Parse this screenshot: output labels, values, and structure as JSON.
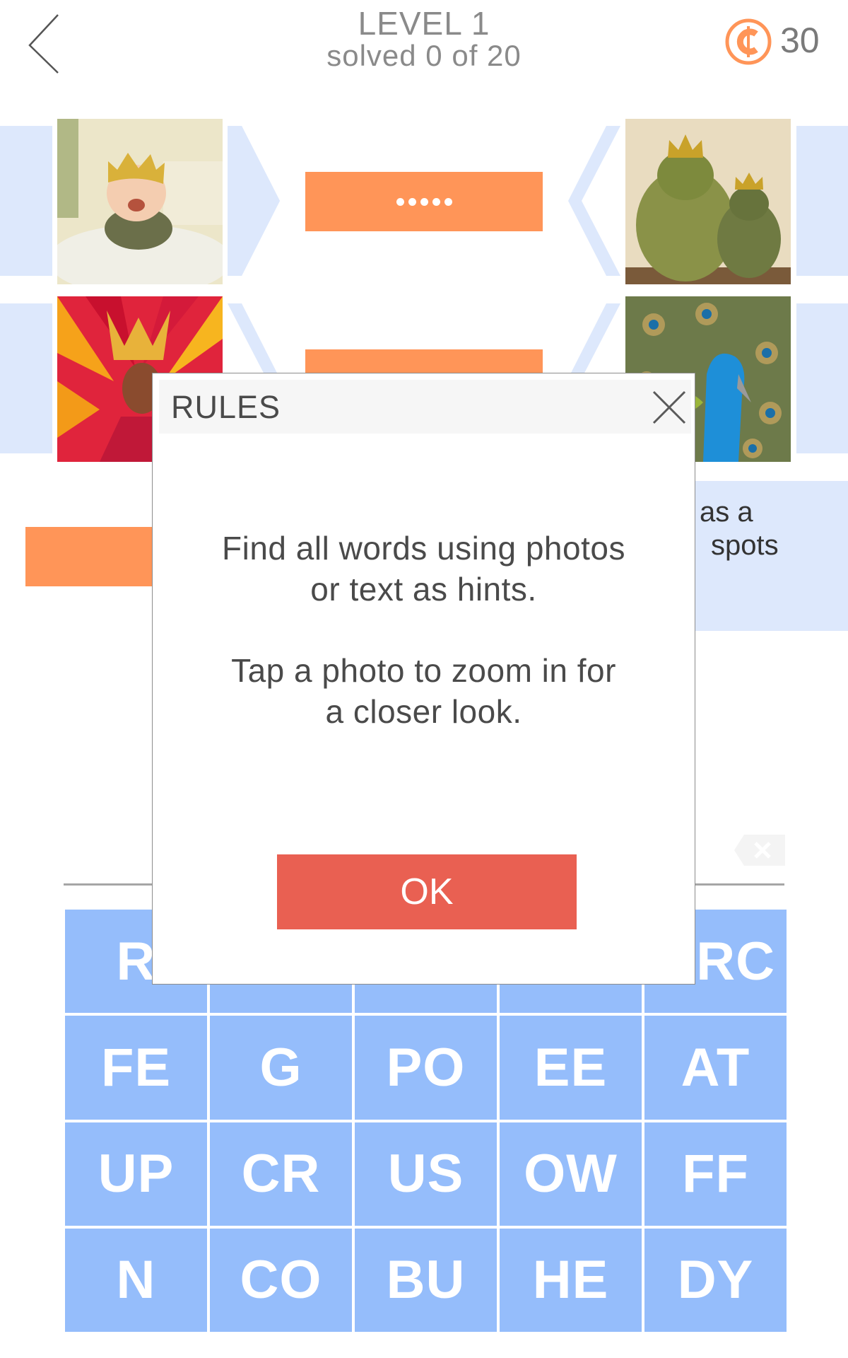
{
  "header": {
    "back_icon": "chevron-left-icon",
    "level": "LEVEL 1",
    "progress": "solved 0 of 20",
    "coin_icon": "coin-icon",
    "coins": "30"
  },
  "puzzle": {
    "photos": [
      {
        "id": "baby",
        "subject": "smiling baby wearing a yellow crown"
      },
      {
        "id": "frogs",
        "subject": "two frog figurines wearing gold crowns"
      },
      {
        "id": "carnival",
        "subject": "carnival dancer with red and orange feather headdress"
      },
      {
        "id": "peacock",
        "subject": "peacock with fanned feathers"
      }
    ],
    "answers": [
      {
        "masked_letters": 5
      },
      {
        "masked_letters": 5
      },
      {
        "masked_letters": 4
      }
    ],
    "text_hint_visible": [
      "as a",
      "spots"
    ]
  },
  "input": {
    "backspace_icon": "backspace-icon"
  },
  "keyboard": {
    "keys": [
      "R",
      "",
      "",
      "",
      "RC",
      "FE",
      "G",
      "PO",
      "EE",
      "AT",
      "UP",
      "CR",
      "US",
      "OW",
      "FF",
      "N",
      "CO",
      "BU",
      "HE",
      "DY"
    ]
  },
  "dialog": {
    "title": "RULES",
    "close_icon": "close-icon",
    "paragraph1_line1": "Find all words using photos",
    "paragraph1_line2": "or text as hints.",
    "paragraph2_line1": "Tap a photo to zoom in for",
    "paragraph2_line2": "a closer look.",
    "ok_label": "OK"
  },
  "colors": {
    "accent_orange": "#ff9558",
    "ok_red": "#e96052",
    "key_blue": "#95bdfb",
    "panel_blue": "#dde8fc"
  }
}
